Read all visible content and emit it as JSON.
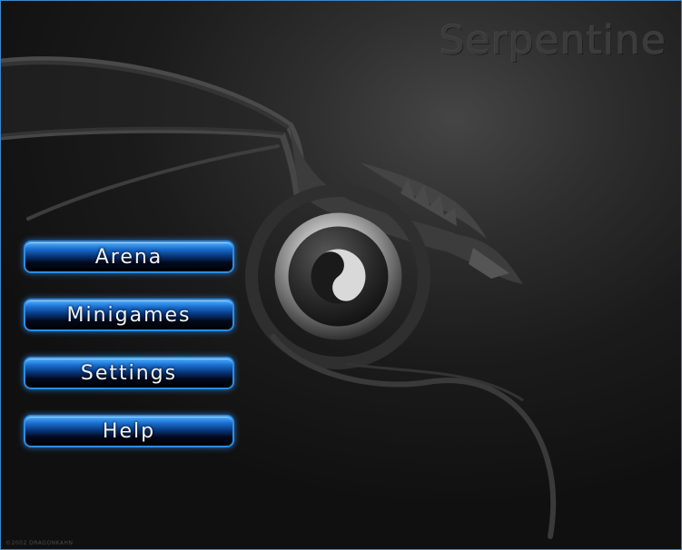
{
  "title": "Serpentine",
  "menu": {
    "items": [
      {
        "label": "Arena"
      },
      {
        "label": "Minigames"
      },
      {
        "label": "Settings"
      },
      {
        "label": "Help"
      }
    ]
  },
  "emblem": {
    "icon": "yin-yang-icon"
  },
  "copyright": "©2002 DRAGONKAHN",
  "colors": {
    "accent": "#2b8de6",
    "button_glow": "#3096ff",
    "background": "#1b1b1b",
    "title": "#3b3b3b"
  }
}
